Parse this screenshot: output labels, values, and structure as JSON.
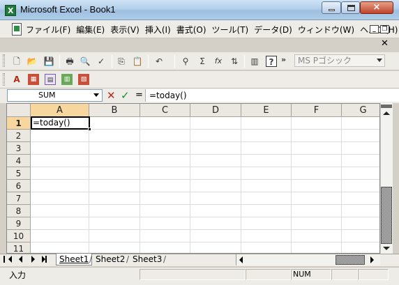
{
  "window": {
    "title": "Microsoft Excel - Book1",
    "app_icon_letter": "X",
    "close_glyph": "×"
  },
  "menu": {
    "items": [
      "ファイル(F)",
      "編集(E)",
      "表示(V)",
      "挿入(I)",
      "書式(O)",
      "ツール(T)",
      "データ(D)",
      "ウィンドウ(W)",
      "ヘルプ(H)"
    ],
    "mdi_min_glyph": "_",
    "mdi_restore_glyph": "❐",
    "mdi_close_glyph": "✕"
  },
  "toolbar": {
    "font_name": "MS Pゴシック",
    "chevrons": "»",
    "icons": {
      "new": "🗋",
      "open": "📂",
      "save": "💾",
      "print": "🖶",
      "preview": "🔍",
      "spell": "✓",
      "copy": "⎘",
      "paste": "📋",
      "undo": "↶",
      "hyperlink": "⚲",
      "autosum": "Σ",
      "function": "fx",
      "sort": "⇅",
      "chart": "▥",
      "help": "?"
    }
  },
  "formula_bar": {
    "name_box": "SUM",
    "cancel_glyph": "✕",
    "enter_glyph": "✓",
    "equals_glyph": "=",
    "formula": "=today()"
  },
  "sheet": {
    "columns": [
      "A",
      "B",
      "C",
      "D",
      "E",
      "F",
      "G"
    ],
    "rows": [
      "1",
      "2",
      "3",
      "4",
      "5",
      "6",
      "7",
      "8",
      "9",
      "10",
      "11"
    ],
    "active_cell_value": "=today()"
  },
  "tabs": [
    "Sheet1",
    "Sheet2",
    "Sheet3"
  ],
  "status": {
    "mode": "入力",
    "num": "NUM"
  },
  "colors": {
    "header_highlight": "#f8d79f",
    "cancel_red": "#c0271a",
    "enter_green": "#1e8c2b",
    "excel_green": "#1f7a3a"
  }
}
